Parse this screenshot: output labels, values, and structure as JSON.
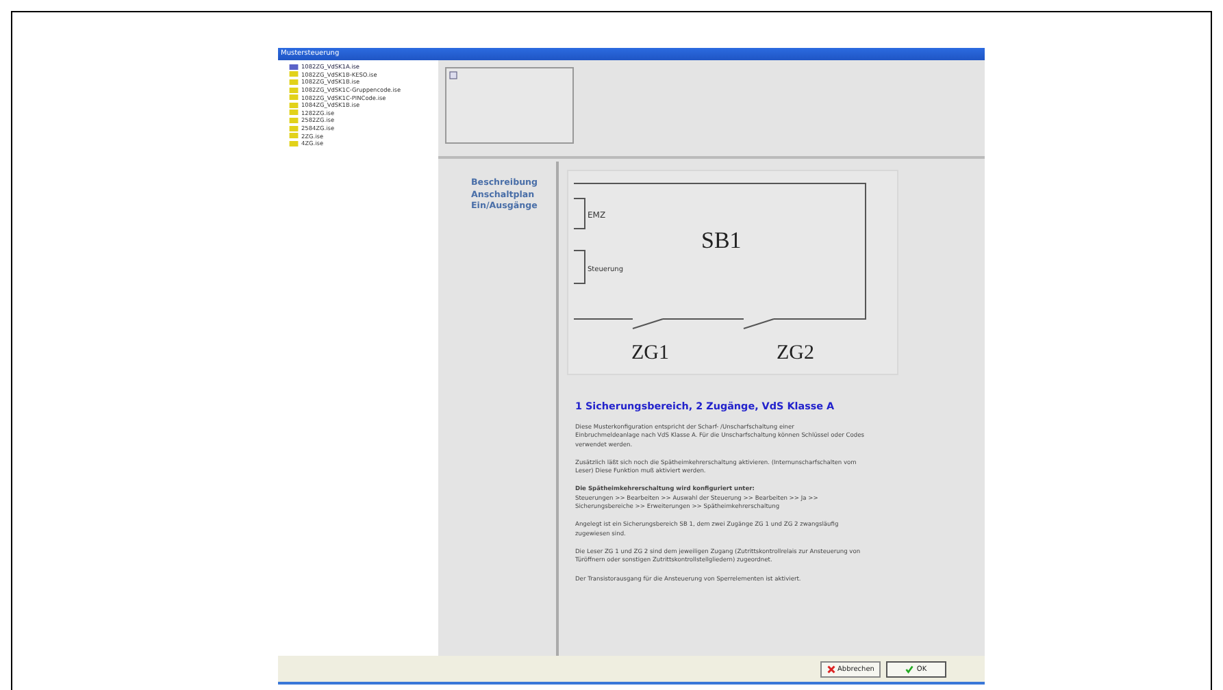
{
  "window": {
    "title": "Mustersteuerung"
  },
  "tree": {
    "items": [
      {
        "label": "1082ZG_VdSK1A.ise",
        "selected": true
      },
      {
        "label": "1082ZG_VdSK1B-KESO.ise",
        "selected": false
      },
      {
        "label": "1082ZG_VdSK1B.ise",
        "selected": false
      },
      {
        "label": "1082ZG_VdSK1C-Gruppencode.ise",
        "selected": false
      },
      {
        "label": "1082ZG_VdSK1C-PINCode.ise",
        "selected": false
      },
      {
        "label": "1084ZG_VdSK1B.ise",
        "selected": false
      },
      {
        "label": "1282ZG.ise",
        "selected": false
      },
      {
        "label": "2582ZG.ise",
        "selected": false
      },
      {
        "label": "2584ZG.ise",
        "selected": false
      },
      {
        "label": "2ZG.ise",
        "selected": false
      },
      {
        "label": "4ZG.ise",
        "selected": false
      }
    ]
  },
  "nav": [
    "Beschreibung",
    "Anschaltplan",
    "Ein/Ausgänge"
  ],
  "diagram": {
    "area": "SB1",
    "inputs": [
      "EMZ",
      "Steuerung"
    ],
    "doors": [
      "ZG1",
      "ZG2"
    ]
  },
  "heading": "1 Sicherungsbereich, 2 Zugänge, VdS Klasse A",
  "paragraphs": [
    {
      "lines": [
        "Diese Musterkonfiguration entspricht der Scharf- /Unscharfschaltung einer",
        "Einbruchmeldeanlage nach VdS Klasse A. Für die Unscharfschaltung können Schlüssel oder Codes",
        "verwendet werden."
      ]
    },
    {
      "lines": [
        "Zusätzlich läßt sich noch die Spätheimkehrerschaltung aktivieren. (Internunscharfschalten vom",
        "Leser) Diese Funktion muß aktiviert werden."
      ]
    },
    {
      "lines": [
        "**Die Spätheimkehrerschaltung wird konfiguriert unter:**",
        "Steuerungen >> Bearbeiten >> Auswahl der Steuerung >> Bearbeiten >> Ja >>",
        "Sicherungsbereiche >> Erweiterungen >> Spätheimkehrerschaltung"
      ]
    },
    {
      "lines": [
        "Angelegt ist ein Sicherungsbereich SB 1, dem zwei Zugänge ZG 1 und ZG 2 zwangsläufig",
        "zugewiesen sind."
      ]
    },
    {
      "lines": [
        "Die Leser ZG 1 und ZG 2 sind dem jeweiligen Zugang (Zutrittskontrollrelais zur Ansteuerung von",
        "Türöffnern oder sonstigen Zutrittskontrollstellgliedern) zugeordnet."
      ]
    },
    {
      "lines": [
        "Der Transistorausgang für die Ansteuerung von Sperrelementen ist aktiviert."
      ]
    }
  ],
  "buttons": [
    {
      "label": "Abbrechen",
      "kind": "cancel"
    },
    {
      "label": "OK",
      "kind": "ok"
    }
  ]
}
